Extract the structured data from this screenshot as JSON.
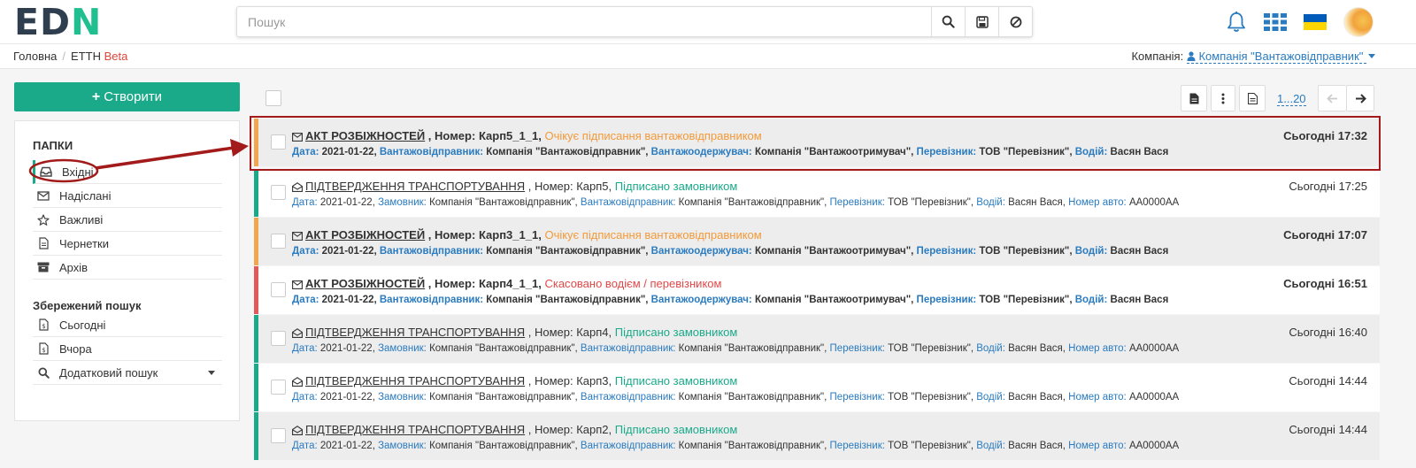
{
  "header": {
    "logo_part1": "ED",
    "logo_part2": "N",
    "search_placeholder": "Пошук",
    "icons": [
      "search-icon",
      "save-icon",
      "clear-icon",
      "bell-icon",
      "apps-grid-icon",
      "ukraine-flag-icon",
      "avatar"
    ]
  },
  "breadcrumb": {
    "home": "Головна",
    "section": "ЕТТН",
    "badge": "Beta"
  },
  "company": {
    "label": "Компанія:",
    "value": "Компанія \"Вантажовідправник\""
  },
  "sidebar": {
    "create_label": "Створити",
    "folders_heading": "ПАПКИ",
    "folders": [
      {
        "label": "Вхідні",
        "icon": "inbox-icon",
        "active": true
      },
      {
        "label": "Надіслані",
        "icon": "envelope-icon"
      },
      {
        "label": "Важливі",
        "icon": "star-icon"
      },
      {
        "label": "Чернетки",
        "icon": "draft-icon"
      },
      {
        "label": "Архів",
        "icon": "archive-icon"
      }
    ],
    "saved_heading": "Збережений пошук",
    "saved": [
      {
        "label": "Сьогодні",
        "icon": "calendar-file-icon"
      },
      {
        "label": "Вчора",
        "icon": "calendar-file-icon"
      },
      {
        "label": "Додатковий пошук",
        "icon": "search-icon"
      }
    ]
  },
  "toolbar": {
    "pager_text": "1...20",
    "icons": [
      "export-doc-icon",
      "more-vertical-icon",
      "document-icon",
      "arrow-left-icon",
      "arrow-right-icon"
    ]
  },
  "documents": [
    {
      "type": "АКТ РОЗБІЖНОСТЕЙ",
      "number_label": "Номер:",
      "number": "Карп5_1_1",
      "status": "Очікує підписання вантажовідправником",
      "status_color": "#f29a3a",
      "time": "Сьогодні 17:32",
      "unread": true,
      "row_style": "gray",
      "accent": "orange",
      "date_label": "Дата:",
      "date": "2021-01-22",
      "party1_label": "Вантажовідправник:",
      "party1": "Компанія \"Вантажовідправник\"",
      "party2_label": "Вантажоодержувач:",
      "party2": "Компанія \"Вантажоотримувач\"",
      "carrier_label": "Перевізник:",
      "carrier": "ТОВ \"Перевізник\"",
      "driver_label": "Водій:",
      "driver": "Васян Вася"
    },
    {
      "type": "ПІДТВЕРДЖЕННЯ ТРАНСПОРТУВАННЯ",
      "number_label": "Номер:",
      "number": "Карп5",
      "status": "Підписано замовником",
      "status_color": "#1aaa8a",
      "time": "Сьогодні 17:25",
      "unread": false,
      "row_style": "white",
      "accent": "green",
      "date_label": "Дата:",
      "date": "2021-01-22",
      "party1_label": "Замовник:",
      "party1": "Компанія \"Вантажовідправник\"",
      "party2_label": "Вантажовідправник:",
      "party2": "Компанія \"Вантажовідправник\"",
      "carrier_label": "Перевізник:",
      "carrier": "ТОВ \"Перевізник\"",
      "driver_label": "Водій:",
      "driver": "Васян Вася",
      "plate_label": "Номер авто:",
      "plate": "АА0000АА"
    },
    {
      "type": "АКТ РОЗБІЖНОСТЕЙ",
      "number_label": "Номер:",
      "number": "Карп3_1_1",
      "status": "Очікує підписання вантажовідправником",
      "status_color": "#f29a3a",
      "time": "Сьогодні 17:07",
      "unread": true,
      "row_style": "gray",
      "accent": "orange",
      "date_label": "Дата:",
      "date": "2021-01-22",
      "party1_label": "Вантажовідправник:",
      "party1": "Компанія \"Вантажовідправник\"",
      "party2_label": "Вантажоодержувач:",
      "party2": "Компанія \"Вантажоотримувач\"",
      "carrier_label": "Перевізник:",
      "carrier": "ТОВ \"Перевізник\"",
      "driver_label": "Водій:",
      "driver": "Васян Вася"
    },
    {
      "type": "АКТ РОЗБІЖНОСТЕЙ",
      "number_label": "Номер:",
      "number": "Карп4_1_1",
      "status": "Скасовано водієм / перевізником",
      "status_color": "#e14848",
      "time": "Сьогодні 16:51",
      "unread": true,
      "row_style": "white",
      "accent": "red",
      "date_label": "Дата:",
      "date": "2021-01-22",
      "party1_label": "Вантажовідправник:",
      "party1": "Компанія \"Вантажовідправник\"",
      "party2_label": "Вантажоодержувач:",
      "party2": "Компанія \"Вантажоотримувач\"",
      "carrier_label": "Перевізник:",
      "carrier": "ТОВ \"Перевізник\"",
      "driver_label": "Водій:",
      "driver": "Васян Вася"
    },
    {
      "type": "ПІДТВЕРДЖЕННЯ ТРАНСПОРТУВАННЯ",
      "number_label": "Номер:",
      "number": "Карп4",
      "status": "Підписано замовником",
      "status_color": "#1aaa8a",
      "time": "Сьогодні 16:40",
      "unread": false,
      "row_style": "gray",
      "accent": "green",
      "date_label": "Дата:",
      "date": "2021-01-22",
      "party1_label": "Замовник:",
      "party1": "Компанія \"Вантажовідправник\"",
      "party2_label": "Вантажовідправник:",
      "party2": "Компанія \"Вантажовідправник\"",
      "carrier_label": "Перевізник:",
      "carrier": "ТОВ \"Перевізник\"",
      "driver_label": "Водій:",
      "driver": "Васян Вася",
      "plate_label": "Номер авто:",
      "plate": "АА0000АА"
    },
    {
      "type": "ПІДТВЕРДЖЕННЯ ТРАНСПОРТУВАННЯ",
      "number_label": "Номер:",
      "number": "Карп3",
      "status": "Підписано замовником",
      "status_color": "#1aaa8a",
      "time": "Сьогодні 14:44",
      "unread": false,
      "row_style": "white",
      "accent": "green",
      "date_label": "Дата:",
      "date": "2021-01-22",
      "party1_label": "Замовник:",
      "party1": "Компанія \"Вантажовідправник\"",
      "party2_label": "Вантажовідправник:",
      "party2": "Компанія \"Вантажовідправник\"",
      "carrier_label": "Перевізник:",
      "carrier": "ТОВ \"Перевізник\"",
      "driver_label": "Водій:",
      "driver": "Васян Вася",
      "plate_label": "Номер авто:",
      "plate": "АА0000АА"
    },
    {
      "type": "ПІДТВЕРДЖЕННЯ ТРАНСПОРТУВАННЯ",
      "number_label": "Номер:",
      "number": "Карп2",
      "status": "Підписано замовником",
      "status_color": "#1aaa8a",
      "time": "Сьогодні 14:44",
      "unread": false,
      "row_style": "gray",
      "accent": "green",
      "date_label": "Дата:",
      "date": "2021-01-22",
      "party1_label": "Замовник:",
      "party1": "Компанія \"Вантажовідправник\"",
      "party2_label": "Вантажовідправник:",
      "party2": "Компанія \"Вантажовідправник\"",
      "carrier_label": "Перевізник:",
      "carrier": "ТОВ \"Перевізник\"",
      "driver_label": "Водій:",
      "driver": "Васян Вася",
      "plate_label": "Номер авто:",
      "plate": "АА0000АА"
    }
  ],
  "annotation": {
    "color": "#a21a1a",
    "target": "Вхідні → first document"
  }
}
